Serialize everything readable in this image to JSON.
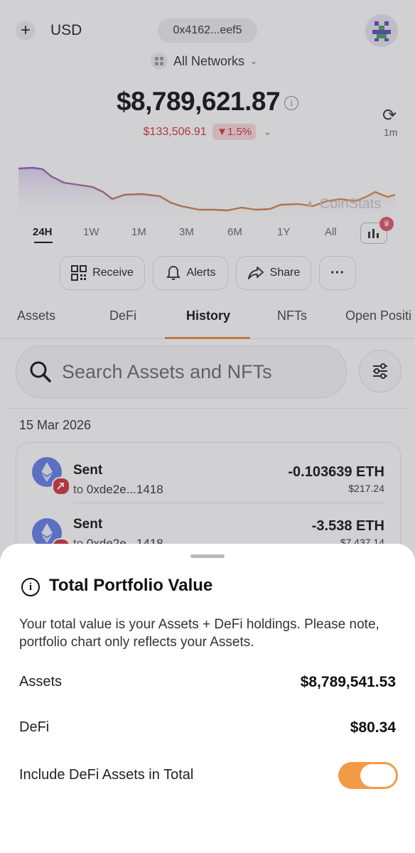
{
  "header": {
    "plus_icon": "plus-icon",
    "currency": "USD",
    "address": "0x4162...eef5",
    "network_selector": "All Networks"
  },
  "portfolio": {
    "total": "$8,789,621.87",
    "change_value": "$133,506.91",
    "change_percent": "▼1.5%",
    "refresh_time": "1m",
    "watermark": "CoinStats"
  },
  "chart_ranges": [
    "24H",
    "1W",
    "1M",
    "3M",
    "6M",
    "1Y",
    "All"
  ],
  "chart_active_range": "24H",
  "actions": {
    "receive": "Receive",
    "alerts": "Alerts",
    "share": "Share",
    "more": "···"
  },
  "tabs": [
    "Assets",
    "DeFi",
    "History",
    "NFTs",
    "Open Positi"
  ],
  "active_tab": "History",
  "search": {
    "placeholder": "Search Assets and NFTs"
  },
  "history": {
    "date": "15 Mar 2026",
    "transactions": [
      {
        "type": "Sent",
        "to_prefix": "to",
        "to": "0xde2e...1418",
        "amount": "-0.103639 ETH",
        "usd": "$217.24"
      },
      {
        "type": "Sent",
        "to_prefix": "to",
        "to": "0xde2e...1418",
        "amount": "-3.538 ETH",
        "usd": "$7,437.14"
      }
    ]
  },
  "sheet": {
    "title": "Total Portfolio Value",
    "description": "Your total value is your Assets + DeFi holdings. Please note, portfolio chart only reflects your Assets.",
    "assets_label": "Assets",
    "assets_value": "$8,789,541.53",
    "defi_label": "DeFi",
    "defi_value": "$80.34",
    "toggle_label": "Include DeFi Assets in Total",
    "toggle_on": true
  },
  "colors": {
    "accent": "#f39a47",
    "negative": "#d4333c",
    "chart_start": "#8a5fc7",
    "chart_end": "#e08a3a"
  }
}
